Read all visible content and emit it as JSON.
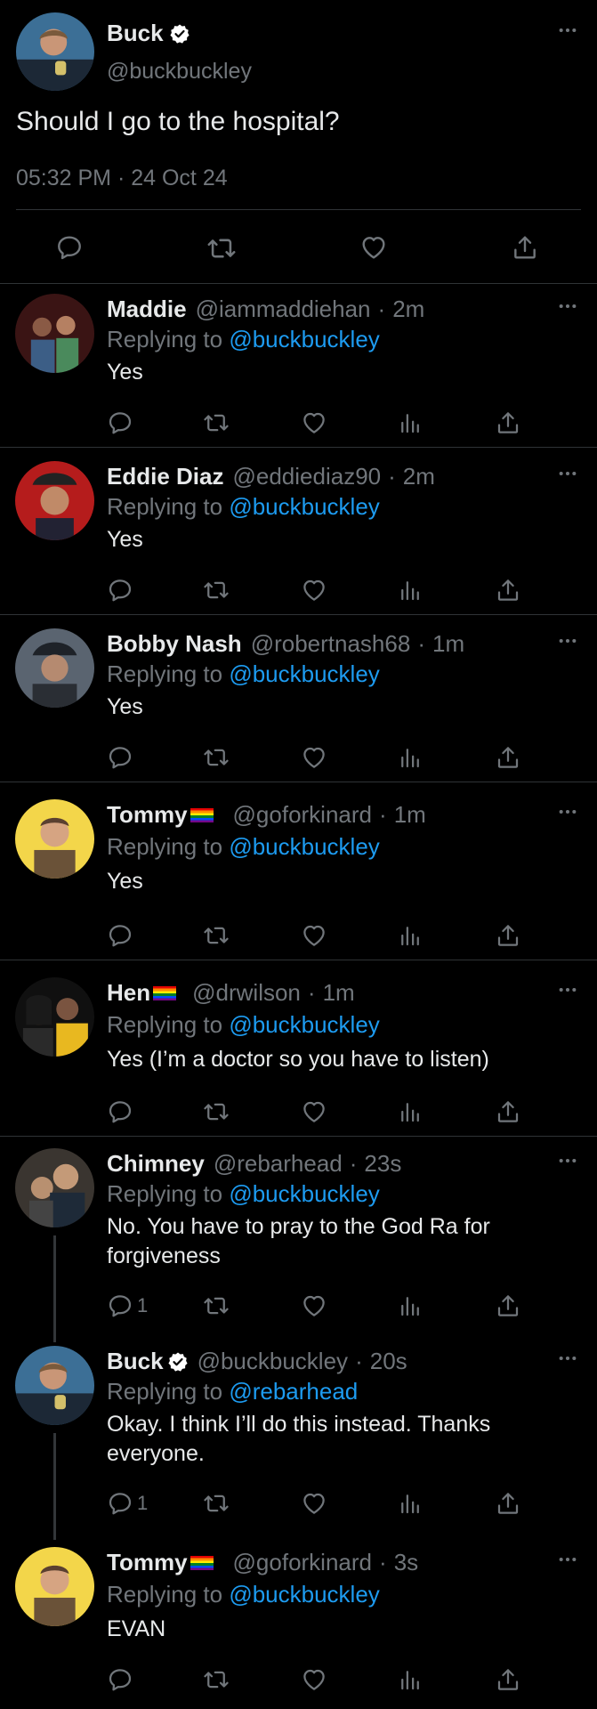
{
  "colors": {
    "background": "#000000",
    "text": "#e7e9ea",
    "secondary": "#71767b",
    "link": "#1d9bf0",
    "divider": "#2f3336"
  },
  "icons": {
    "reply": "speech-bubble-icon",
    "retweet": "retweet-icon",
    "like": "heart-icon",
    "views": "bar-chart-icon",
    "share": "share-upload-icon",
    "more": "ellipsis-icon",
    "verified": "verified-badge-icon",
    "pride": "rainbow-flag-icon"
  },
  "main_tweet": {
    "name": "Buck",
    "handle": "@buckbuckley",
    "text": "Should I go to the hospital?",
    "timestamp": "05:32 PM · 24 Oct 24"
  },
  "replies": [
    {
      "name": "Maddie",
      "handle": "@iammaddiehan",
      "time": "2m",
      "replying_prefix": "Replying to ",
      "replying_to": "@buckbuckley",
      "text": "Yes",
      "reply_count": ""
    },
    {
      "name": "Eddie Diaz",
      "handle": "@eddiediaz90",
      "time": "2m",
      "replying_prefix": "Replying to ",
      "replying_to": "@buckbuckley",
      "text": "Yes",
      "reply_count": ""
    },
    {
      "name": "Bobby Nash",
      "handle": "@robertnash68",
      "time": "1m",
      "replying_prefix": "Replying to ",
      "replying_to": "@buckbuckley",
      "text": "Yes",
      "reply_count": ""
    },
    {
      "name": "Tommy",
      "handle": "@goforkinard",
      "time": "1m",
      "replying_prefix": "Replying to ",
      "replying_to": "@buckbuckley",
      "text": "Yes",
      "reply_count": ""
    },
    {
      "name": "Hen",
      "handle": "@drwilson",
      "time": "1m",
      "replying_prefix": "Replying to ",
      "replying_to": "@buckbuckley",
      "text": "Yes (I’m a doctor so you have to listen)",
      "reply_count": ""
    },
    {
      "name": "Chimney",
      "handle": "@rebarhead",
      "time": "23s",
      "replying_prefix": "Replying to ",
      "replying_to": "@buckbuckley",
      "text": "No. You have to pray to the God Ra for forgiveness",
      "reply_count": "1"
    },
    {
      "name": "Buck",
      "handle": "@buckbuckley",
      "time": "20s",
      "replying_prefix": "Replying to ",
      "replying_to": "@rebarhead",
      "text": "Okay. I think I’ll do this instead. Thanks everyone.",
      "reply_count": "1"
    },
    {
      "name": "Tommy",
      "handle": "@goforkinard",
      "time": "3s",
      "replying_prefix": "Replying to ",
      "replying_to": "@buckbuckley",
      "text": "EVAN",
      "reply_count": ""
    }
  ]
}
